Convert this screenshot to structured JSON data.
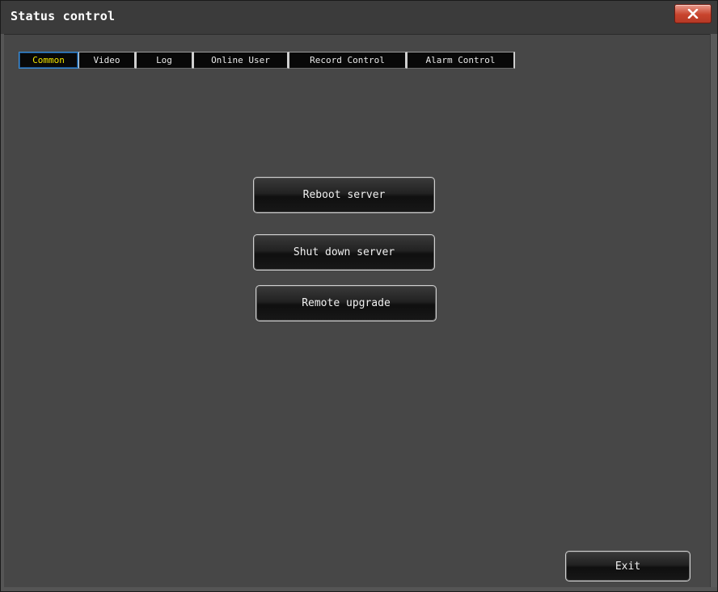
{
  "window": {
    "title": "Status control",
    "close_icon": "close-x-icon"
  },
  "tabs": [
    {
      "label": "Common",
      "active": true
    },
    {
      "label": "Video",
      "active": false
    },
    {
      "label": "Log",
      "active": false
    },
    {
      "label": "Online User",
      "active": false
    },
    {
      "label": "Record Control",
      "active": false
    },
    {
      "label": "Alarm Control",
      "active": false
    }
  ],
  "actions": {
    "reboot_label": "Reboot server",
    "shutdown_label": "Shut down server",
    "upgrade_label": "Remote upgrade"
  },
  "footer": {
    "exit_label": "Exit"
  },
  "colors": {
    "background": "#474747",
    "active_tab_text": "#f5e800",
    "active_tab_border": "#3d8fd6",
    "close_button": "#c8442d"
  }
}
